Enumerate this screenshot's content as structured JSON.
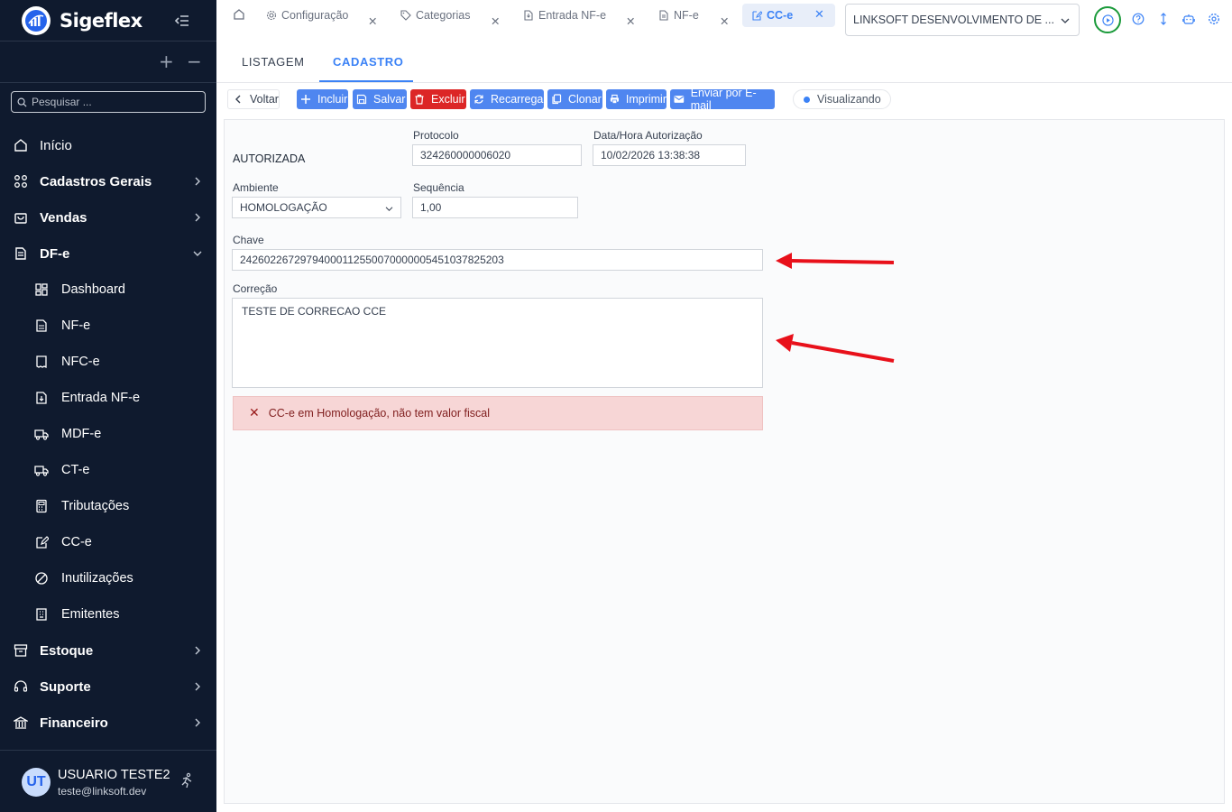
{
  "app": {
    "name": "Sigeflex"
  },
  "sidebar": {
    "search_placeholder": "Pesquisar ...",
    "tree_controls": {
      "expand": "+",
      "collapse": "−"
    },
    "items": [
      {
        "label": "Início",
        "icon": "home-icon",
        "bold": false
      },
      {
        "label": "Cadastros Gerais",
        "icon": "grid-icon",
        "bold": true
      },
      {
        "label": "Vendas",
        "icon": "bag-icon",
        "bold": true
      },
      {
        "label": "DF-e",
        "icon": "document-icon",
        "bold": true,
        "expanded": true
      },
      {
        "label": "Dashboard",
        "icon": "dashboard-icon",
        "sub": true
      },
      {
        "label": "NF-e",
        "icon": "file-icon",
        "sub": true
      },
      {
        "label": "NFC-e",
        "icon": "receipt-icon",
        "sub": true
      },
      {
        "label": "Entrada NF-e",
        "icon": "file-import-icon",
        "sub": true
      },
      {
        "label": "MDF-e",
        "icon": "truck-icon",
        "sub": true
      },
      {
        "label": "CT-e",
        "icon": "truck-icon",
        "sub": true
      },
      {
        "label": "Tributações",
        "icon": "calculator-icon",
        "sub": true
      },
      {
        "label": "CC-e",
        "icon": "edit-file-icon",
        "sub": true
      },
      {
        "label": "Inutilizações",
        "icon": "ban-icon",
        "sub": true
      },
      {
        "label": "Emitentes",
        "icon": "building-icon",
        "sub": true
      },
      {
        "label": "Estoque",
        "icon": "archive-icon",
        "bold": true
      },
      {
        "label": "Suporte",
        "icon": "headset-icon",
        "bold": true
      },
      {
        "label": "Financeiro",
        "icon": "bank-icon",
        "bold": true
      }
    ],
    "user": {
      "initials": "UT",
      "name": "USUARIO TESTE2",
      "email": "teste@linksoft.dev"
    }
  },
  "tabs": [
    {
      "label": "Configuração",
      "icon": "gear-icon"
    },
    {
      "label": "Categorias",
      "icon": "tag-icon"
    },
    {
      "label": "Entrada NF-e",
      "icon": "file-import-icon"
    },
    {
      "label": "NF-e",
      "icon": "file-icon"
    },
    {
      "label": "CC-e",
      "icon": "edit-file-icon",
      "active": true
    }
  ],
  "company_select": {
    "value": "LINKSOFT DESENVOLVIMENTO DE ..."
  },
  "subtabs": [
    {
      "label": "LISTAGEM"
    },
    {
      "label": "CADASTRO",
      "active": true
    }
  ],
  "toolbar": {
    "back": "Voltar",
    "include": "Incluir",
    "save": "Salvar",
    "delete": "Excluir",
    "reload": "Recarrega",
    "clone": "Clonar",
    "print": "Imprimir",
    "email": "Enviar por E-mail",
    "status": "Visualizando"
  },
  "form": {
    "status": "AUTORIZADA",
    "protocolo": {
      "label": "Protocolo",
      "value": "324260000006020"
    },
    "data_hora": {
      "label": "Data/Hora Autorização",
      "value": "10/02/2026 13:38:38"
    },
    "ambiente": {
      "label": "Ambiente",
      "value": "HOMOLOGAÇÃO"
    },
    "sequencia": {
      "label": "Sequência",
      "value": "1,00"
    },
    "chave": {
      "label": "Chave",
      "value": "24260226729794000112550070000005451037825203"
    },
    "correcao": {
      "label": "Correção",
      "value": "TESTE DE CORRECAO CCE"
    },
    "alert": "CC-e em Homologação, não tem valor fiscal"
  },
  "colors": {
    "sidebar_bg": "#0f1a2e",
    "primary": "#4f86f0",
    "danger": "#dc2626",
    "alert_bg": "#f7d6d6",
    "annotation_arrow": "#e8101a",
    "run_ring": "#1a9a3a"
  }
}
